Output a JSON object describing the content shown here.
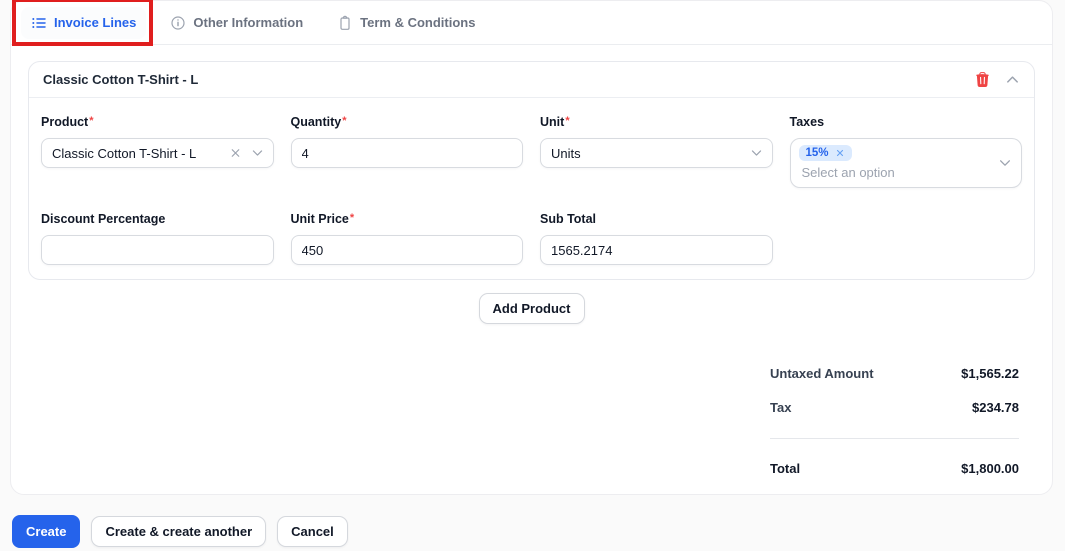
{
  "tabs": [
    {
      "label": "Invoice Lines",
      "icon": "list-icon",
      "active": true,
      "annotated": true
    },
    {
      "label": "Other Information",
      "icon": "info-icon",
      "active": false
    },
    {
      "label": "Term & Conditions",
      "icon": "clipboard-icon",
      "active": false
    }
  ],
  "line_item": {
    "title": "Classic Cotton T-Shirt - L",
    "fields": {
      "product": {
        "label": "Product",
        "required": true,
        "value": "Classic Cotton T-Shirt - L"
      },
      "quantity": {
        "label": "Quantity",
        "required": true,
        "value": "4"
      },
      "unit": {
        "label": "Unit",
        "required": true,
        "value": "Units"
      },
      "taxes": {
        "label": "Taxes",
        "required": false,
        "chips": [
          "15%"
        ],
        "placeholder": "Select an option"
      },
      "discount": {
        "label": "Discount Percentage",
        "required": false,
        "value": ""
      },
      "unit_price": {
        "label": "Unit Price",
        "required": true,
        "value": "450"
      },
      "sub_total": {
        "label": "Sub Total",
        "required": false,
        "value": "1565.2174"
      }
    }
  },
  "add_product_label": "Add Product",
  "totals": {
    "rows": [
      {
        "label": "Untaxed Amount",
        "value": "$1,565.22"
      },
      {
        "label": "Tax",
        "value": "$234.78"
      }
    ],
    "total_label": "Total",
    "total_value": "$1,800.00"
  },
  "footer": {
    "create_label": "Create",
    "create_another_label": "Create & create another",
    "cancel_label": "Cancel"
  },
  "colors": {
    "accent_blue": "#2563eb",
    "annotation_red": "#e01e1e",
    "danger_red": "#ef4444",
    "chip_bg": "#dbeafe",
    "chip_text": "#2563eb",
    "page_bg": "#fafafa"
  }
}
